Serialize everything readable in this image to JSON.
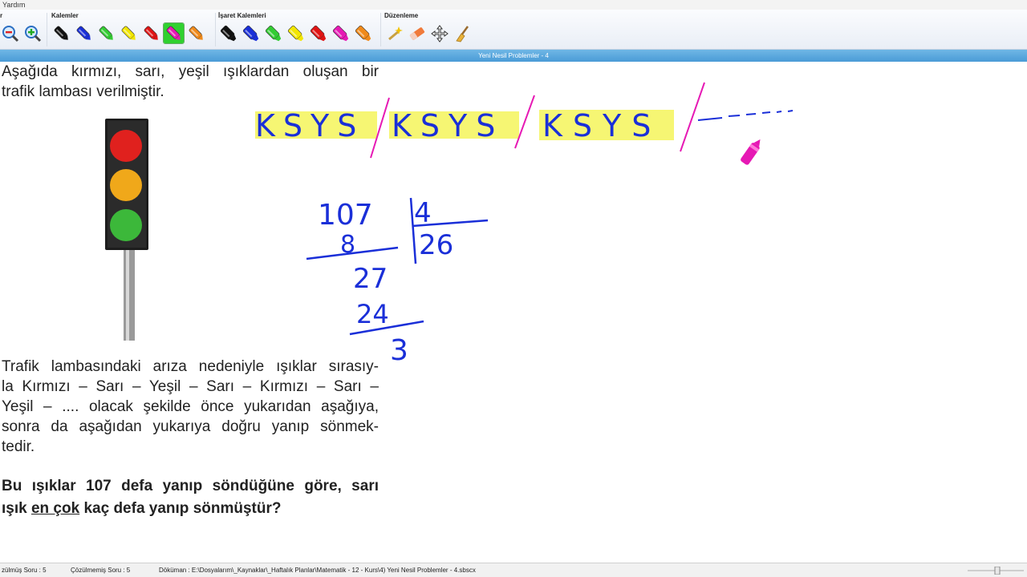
{
  "menu": {
    "help": "Yardım",
    "edge_fragment": "r"
  },
  "toolbar": {
    "groups": {
      "pens": "Kalemler",
      "markers": "İşaret Kalemleri",
      "edit": "Düzenleme"
    },
    "pen_colors": [
      "#111111",
      "#1a2fd8",
      "#33cc33",
      "#f2e600",
      "#e01414",
      "#e619b4",
      "#f08a1a"
    ],
    "marker_colors": [
      "#111111",
      "#1a2fd8",
      "#33cc33",
      "#f2e600",
      "#e01414",
      "#e619b4",
      "#f08a1a"
    ],
    "active_pen": "#e619b4"
  },
  "document": {
    "title": "Yeni Nesil Problemler - 4"
  },
  "question": {
    "intro_line1": "Aşağıda kırmızı, sarı, yeşil ışıklardan oluşan bir",
    "intro_line2": "trafik lambası verilmiştir.",
    "body_line1": "Trafik lambasındaki arıza nedeniyle ışıklar sırasıy-",
    "body_line2": "la Kırmızı – Sarı – Yeşil – Sarı – Kırmızı – Sarı –",
    "body_line3": "Yeşil – .... olacak şekilde önce yukarıdan aşağıya,",
    "body_line4": "sonra da aşağıdan yukarıya doğru yanıp sönmek-",
    "body_line5": "tedir.",
    "ask_line1": "Bu ışıklar 107 defa yanıp söndüğüne göre, sarı",
    "ask_line2_a": "ışık ",
    "ask_line2_u": "en çok",
    "ask_line2_b": " kaç defa yanıp sönmüştür?"
  },
  "traffic_light": {
    "red": "#e0211e",
    "yellow": "#f0a81a",
    "green": "#3cb83a"
  },
  "handwriting": {
    "pattern_group": "KSYS",
    "dividend": "107",
    "divisor": "4",
    "quotient": "26",
    "sub1": "8",
    "step": "27",
    "sub2": "24",
    "remainder": "3",
    "ink": "#1a2fd8",
    "slash_color": "#e619b4",
    "highlight": "#f5f55a"
  },
  "status": {
    "solved": "zülmüş Soru : 5",
    "unsolved": "Çözülmemiş Soru : 5",
    "doc": "Döküman : E:\\Dosyalarım\\_Kaynaklar\\_Haftalık Planlar\\Matematik - 12 - Kurs\\4) Yeni Nesil Problemler - 4.sbscx"
  }
}
